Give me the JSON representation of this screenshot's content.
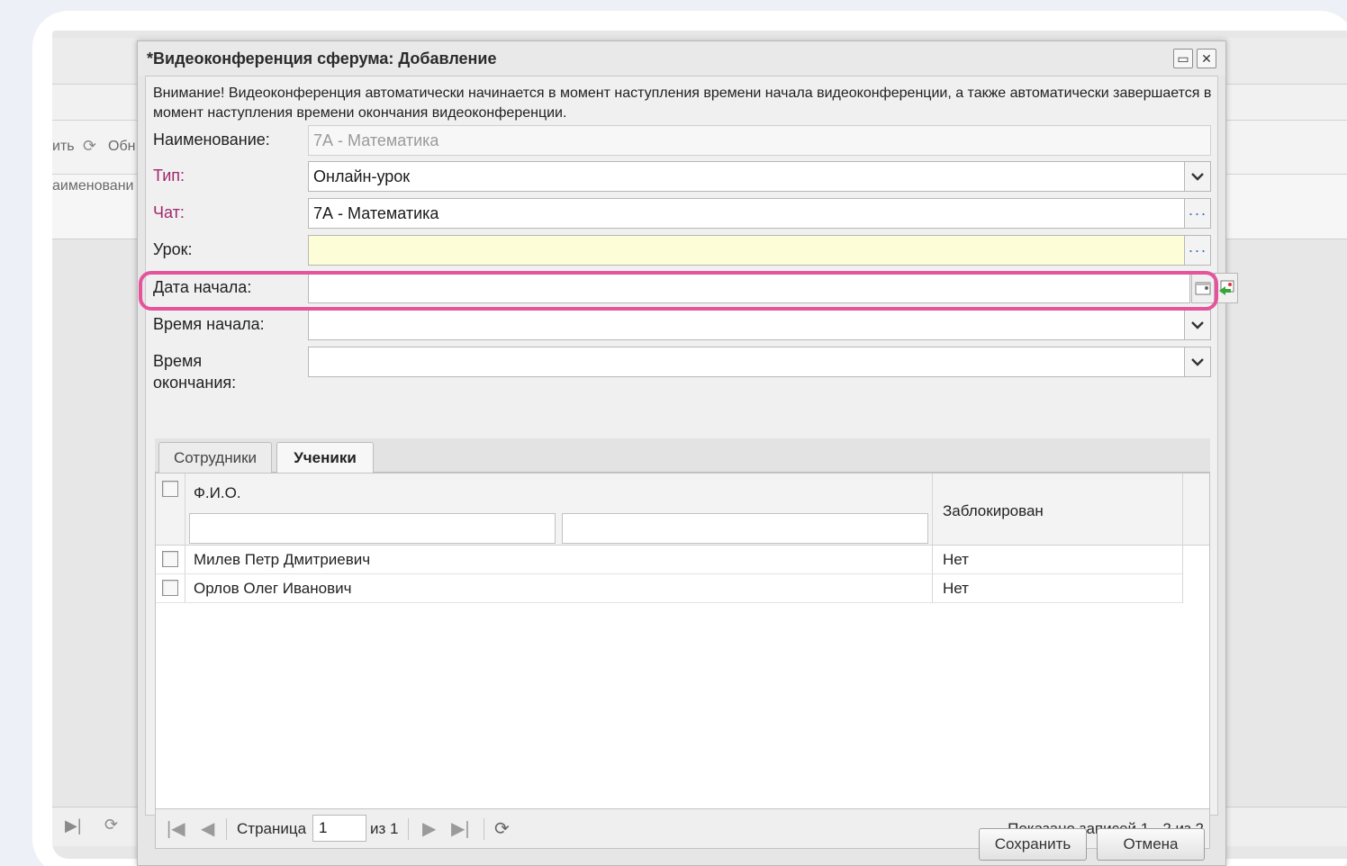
{
  "background_app": {
    "toolbar_fragment": "ить",
    "refresh_fragment": "Обн",
    "column_fragment": "аименовани"
  },
  "dialog": {
    "title": "*Видеоконференция сферума: Добавление",
    "notice": "Внимание! Видеоконференция автоматически начинается в момент наступления времени начала видеоконференции, а также автоматически завершается в момент наступления времени окончания видеоконференции.",
    "fields": {
      "name": {
        "label": "Наименование:",
        "value": "7А - Математика"
      },
      "type": {
        "label": "Тип:",
        "value": "Онлайн-урок"
      },
      "chat": {
        "label": "Чат:",
        "value": "7А - Математика"
      },
      "lesson": {
        "label": "Урок:",
        "value": ""
      },
      "start_date": {
        "label": "Дата начала:",
        "value": ""
      },
      "start_time": {
        "label": "Время начала:",
        "value": ""
      },
      "end_time": {
        "label_line1": "Время",
        "label_line2": "окончания:",
        "value": ""
      }
    },
    "tabs": [
      {
        "label": "Сотрудники",
        "active": false
      },
      {
        "label": "Ученики",
        "active": true
      }
    ],
    "grid": {
      "columns": {
        "fio": "Ф.И.О.",
        "blocked": "Заблокирован"
      },
      "rows": [
        {
          "fio": "Милев Петр Дмитриевич",
          "blocked": "Нет"
        },
        {
          "fio": "Орлов Олег Иванович",
          "blocked": "Нет"
        }
      ]
    },
    "pager": {
      "page_label": "Страница",
      "page_value": "1",
      "of_label": "из 1",
      "summary": "Показано записей 1 - 2 из 2"
    },
    "buttons": {
      "save": "Сохранить",
      "cancel": "Отмена"
    }
  },
  "colors": {
    "required_label": "#a0286e",
    "highlight": "#e6539d",
    "lesson_field_bg": "#fdfdd8"
  }
}
